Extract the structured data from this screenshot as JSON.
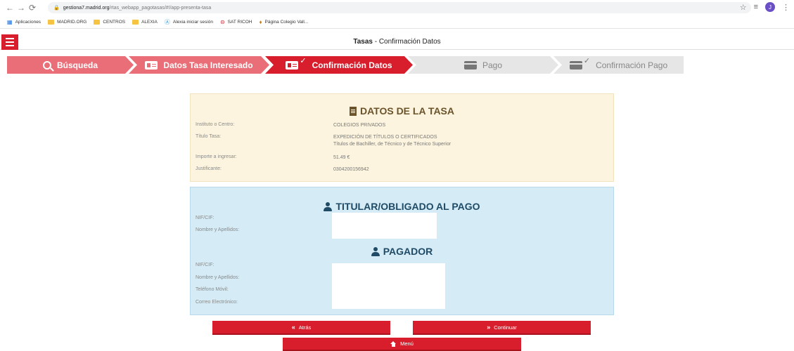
{
  "browser": {
    "url_host": "gestiona7.madrid.org",
    "url_path": "/rtas_webapp_pagotasas/#!/app-presenta-tasa",
    "avatar_letter": "J"
  },
  "bookmarks": [
    {
      "label": "Aplicaciones",
      "icon": "apps-grid-icon"
    },
    {
      "label": "MADRID.ORG",
      "icon": "folder-icon"
    },
    {
      "label": "CENTROS",
      "icon": "folder-icon"
    },
    {
      "label": "ALEXIA",
      "icon": "folder-icon"
    },
    {
      "label": "Alexia iniciar sesión",
      "icon": "alexia-icon"
    },
    {
      "label": "SAT RICOH",
      "icon": "ricoh-icon"
    },
    {
      "label": "Página Colegio Vall...",
      "icon": "school-icon"
    }
  ],
  "header": {
    "title_bold": "Tasas",
    "title_rest": " - Confirmación Datos"
  },
  "steps": [
    {
      "label": "Búsqueda",
      "state": "done"
    },
    {
      "label": "Datos Tasa Interesado",
      "state": "done"
    },
    {
      "label": "Confirmación Datos",
      "state": "active"
    },
    {
      "label": "Pago",
      "state": "todo"
    },
    {
      "label": "Confirmación Pago",
      "state": "todo"
    }
  ],
  "tasa": {
    "title": "DATOS DE LA TASA",
    "instituto_label": "Instituto o Centro:",
    "instituto_value": "COLEGIOS PRIVADOS",
    "titulo_label": "Título Tasa:",
    "titulo_value_1": "EXPEDICIÓN DE TÍTULOS O CERTIFICADOS",
    "titulo_value_2": "Títulos de Bachiller, de Técnico y de Técnico Superior",
    "importe_label": "Importe a ingresar:",
    "importe_value": "51.49 €",
    "justificante_label": "Justificante:",
    "justificante_value": "0304200156942"
  },
  "titular": {
    "title": "TITULAR/OBLIGADO AL PAGO",
    "nif_label": "NIF/CIF:",
    "nombre_label": "Nombre y Apellidos:"
  },
  "pagador": {
    "title": "PAGADOR",
    "nif_label": "NIF/CIF:",
    "nombre_label": "Nombre y Apellidos:",
    "telefono_label": "Teléfono Móvil:",
    "correo_label": "Correo Electrónico:"
  },
  "buttons": {
    "back": "Atrás",
    "next": "Continuar",
    "menu": "Menú"
  },
  "colors": {
    "primary_red": "#d81e2c",
    "done_red": "#ea6e77",
    "tasa_panel_bg": "#fcf4de",
    "titular_panel_bg": "#d5ebf5"
  }
}
